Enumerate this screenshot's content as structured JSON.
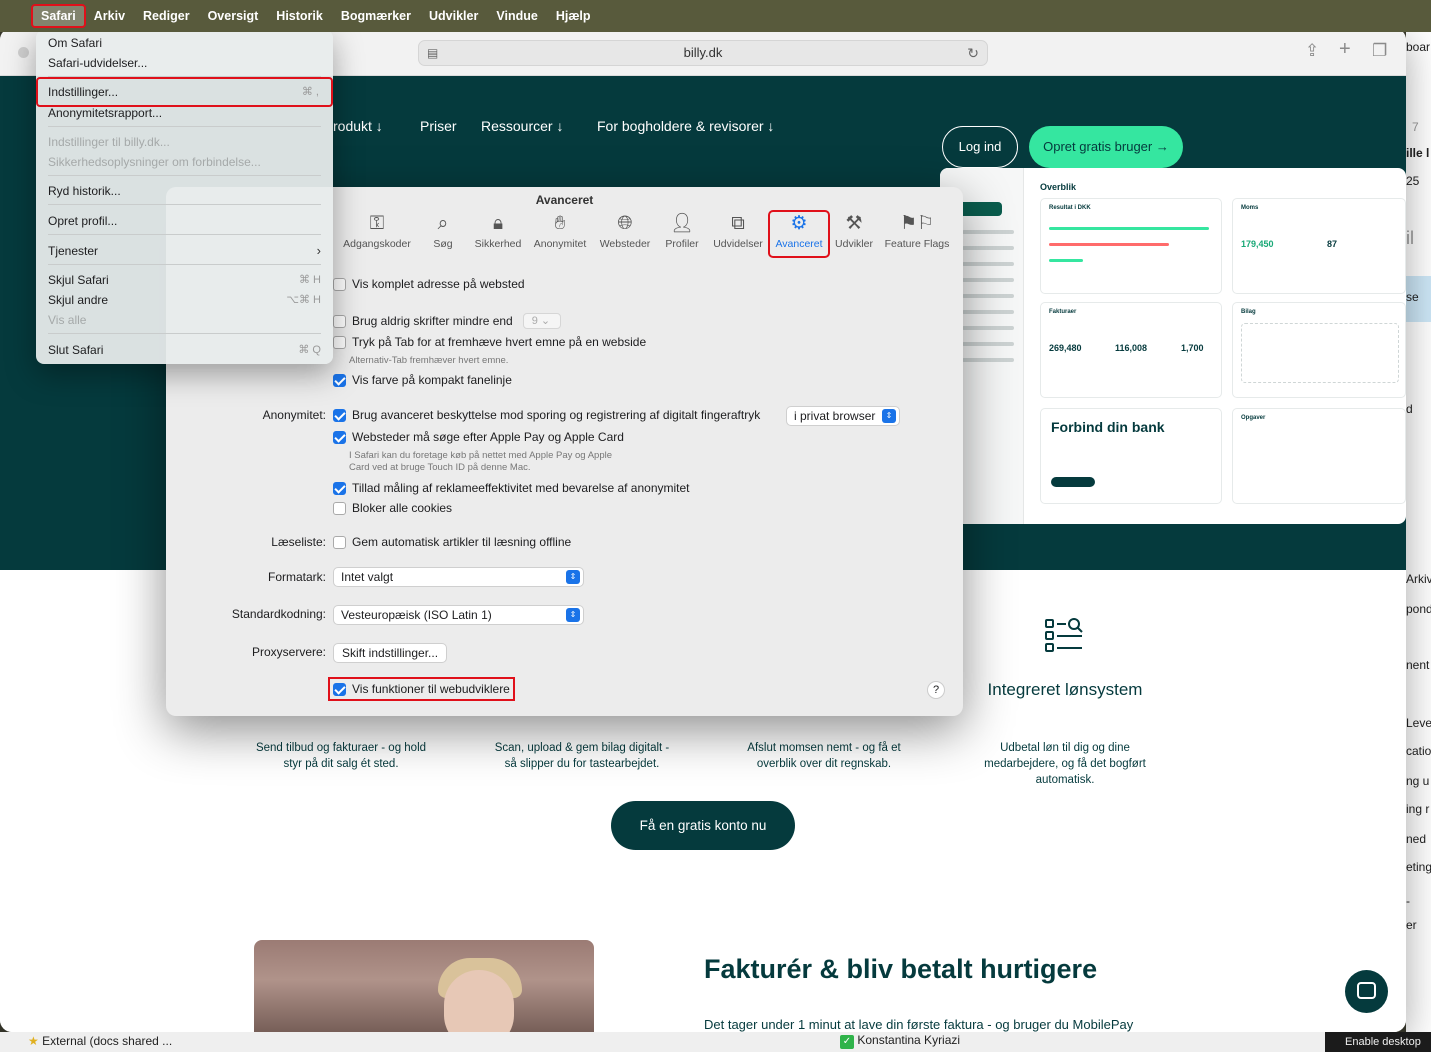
{
  "menubar": {
    "items": [
      "Safari",
      "Arkiv",
      "Rediger",
      "Oversigt",
      "Historik",
      "Bogmærker",
      "Udvikler",
      "Vindue",
      "Hjælp"
    ]
  },
  "browser": {
    "url": "billy.dk"
  },
  "site": {
    "nav": [
      "rodukt ↓",
      "Priser",
      "Ressourcer ↓",
      "For bogholdere & revisorer ↓"
    ],
    "login": "Log ind",
    "signup": "Opret gratis bruger →",
    "dashboard": {
      "title": "Overblik",
      "card1": "Resultat i DKK",
      "card2": "Moms",
      "moms_value": "179,450",
      "moms_days": "87",
      "card3": "Fakturaer",
      "inv1": "269,480",
      "inv2": "116,008",
      "inv3": "1,700",
      "card4": "Bilag",
      "bank": "Forbind din bank",
      "card5": "Opgaver"
    },
    "features": [
      {
        "text": "Send tilbud og fakturaer - og hold styr på dit salg ét sted."
      },
      {
        "text": "Scan, upload & gem bilag digitalt - så slipper du for tastearbejdet."
      },
      {
        "text": "Afslut momsen nemt - og få et overblik over dit regnskab."
      },
      {
        "title": "Integreret lønsystem",
        "text": "Udbetal løn til dig og dine medarbejdere, og få det bogført automatisk."
      }
    ],
    "cta": "Få en gratis konto nu",
    "headline": "Fakturér & bliv betalt hurtigere",
    "subline": "Det tager under 1 minut at lave din første faktura - og bruger du MobilePay"
  },
  "settings": {
    "title": "Avanceret",
    "tabs": [
      {
        "label": "Adgangskoder",
        "icon": "key-icon"
      },
      {
        "label": "Søg",
        "icon": "search-icon"
      },
      {
        "label": "Sikkerhed",
        "icon": "lock-icon"
      },
      {
        "label": "Anonymitet",
        "icon": "hand-icon"
      },
      {
        "label": "Websteder",
        "icon": "globe-icon"
      },
      {
        "label": "Profiler",
        "icon": "person-icon"
      },
      {
        "label": "Udvidelser",
        "icon": "puzzle-icon"
      },
      {
        "label": "Avanceret",
        "icon": "gears-icon"
      },
      {
        "label": "Udvikler",
        "icon": "tools-icon"
      },
      {
        "label": "Feature Flags",
        "icon": "flags-icon"
      }
    ],
    "opt_full_address": "Vis komplet adresse på websted",
    "opt_min_font": "Brug aldrig skrifter mindre end",
    "min_font_value": "9",
    "opt_tab": "Tryk på Tab for at fremhæve hvert emne på en webside",
    "tab_hint": "Alternativ-Tab fremhæver hvert emne.",
    "opt_color": "Vis farve på kompakt fanelinje",
    "label_privacy": "Anonymitet:",
    "opt_fingerprint": "Brug avanceret beskyttelse mod sporing og registrering af digitalt fingeraftryk",
    "fingerprint_select": "i privat browser",
    "opt_applepay": "Websteder må søge efter Apple Pay og Apple Card",
    "applepay_hint1": "I Safari kan du foretage køb på nettet med Apple Pay og Apple",
    "applepay_hint2": "Card ved at bruge Touch ID på denne Mac.",
    "opt_ads": "Tillad måling af reklameeffektivitet med bevarelse af anonymitet",
    "opt_cookies": "Bloker alle cookies",
    "label_reading": "Læseliste:",
    "opt_reading": "Gem automatisk artikler til læsning offline",
    "label_style": "Formatark:",
    "style_value": "Intet valgt",
    "label_encoding": "Standardkodning:",
    "encoding_value": "Vesteuropæisk (ISO Latin 1)",
    "label_proxy": "Proxyservere:",
    "proxy_button": "Skift indstillinger...",
    "opt_dev": "Vis funktioner til webudviklere",
    "help": "?"
  },
  "menu": {
    "about": "Om Safari",
    "extensions": "Safari-udvidelser...",
    "settings": "Indstillinger...",
    "settings_sc": "⌘ ,",
    "privacy_report": "Anonymitetsrapport...",
    "site_settings": "Indstillinger til billy.dk...",
    "security_info": "Sikkerhedsoplysninger om forbindelse...",
    "clear_history": "Ryd historik...",
    "create_profile": "Opret profil...",
    "services": "Tjenester",
    "hide_safari": "Skjul Safari",
    "hide_safari_sc": "⌘ H",
    "hide_others": "Skjul andre",
    "hide_others_sc": "⌥⌘ H",
    "show_all": "Vis alle",
    "quit": "Slut Safari",
    "quit_sc": "⌘ Q"
  },
  "background": {
    "right_texts": [
      "boar",
      "7",
      "ille l",
      "25",
      "il",
      "se",
      "d",
      "Arkiv",
      "pond",
      "nent",
      "Leve",
      "catio",
      "ng u",
      "ing r",
      "ned",
      "eting",
      "-",
      "er"
    ],
    "bottom_left": "External (docs shared ...",
    "bottom_mid": "Konstantina Kyriazi",
    "bottom_right": "Enable desktop"
  }
}
